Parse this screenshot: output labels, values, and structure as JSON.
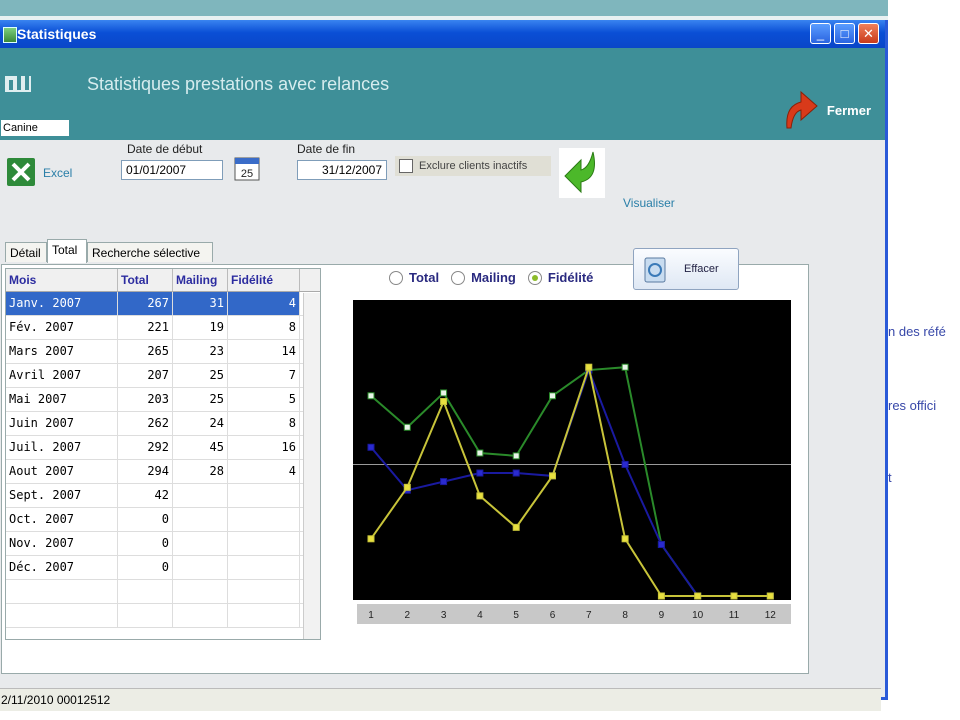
{
  "window": {
    "title": "Statistiques",
    "minimize": "_",
    "maximize": "□",
    "close": "✕"
  },
  "banner": {
    "heading": "Statistiques prestations avec relances",
    "combo_value": "Canine",
    "close_label": "Fermer"
  },
  "toolbar": {
    "excel_label": "Excel",
    "start_label": "Date de début",
    "start_value": "01/01/2007",
    "calendar_day": "25",
    "end_label": "Date de fin",
    "end_value": "31/12/2007",
    "exclude_label": "Exclure clients inactifs",
    "visualize_label": "Visualiser"
  },
  "tabs": [
    "Détail",
    "Total",
    "Recherche sélective"
  ],
  "table": {
    "headers": [
      "Mois",
      "Total",
      "Mailing",
      "Fidélité"
    ],
    "rows": [
      [
        "Janv. 2007",
        "267",
        "31",
        "4"
      ],
      [
        "Fév. 2007",
        "221",
        "19",
        "8"
      ],
      [
        "Mars 2007",
        "265",
        "23",
        "14"
      ],
      [
        "Avril 2007",
        "207",
        "25",
        "7"
      ],
      [
        "Mai 2007",
        "203",
        "25",
        "5"
      ],
      [
        "Juin 2007",
        "262",
        "24",
        "8"
      ],
      [
        "Juil. 2007",
        "292",
        "45",
        "16"
      ],
      [
        "Aout 2007",
        "294",
        "28",
        "4"
      ],
      [
        "Sept. 2007",
        "42",
        "",
        ""
      ],
      [
        "Oct. 2007",
        "0",
        "",
        ""
      ],
      [
        "Nov. 2007",
        "0",
        "",
        ""
      ],
      [
        "Déc. 2007",
        "0",
        "",
        ""
      ]
    ]
  },
  "radio": {
    "total": "Total",
    "mailing": "Mailing",
    "fidelite": "Fidélité",
    "selected": "fidelite"
  },
  "effacer_label": "Effacer",
  "status_text": "2/11/2010 00012512",
  "desktop_right": [
    "n des réfé",
    "res offici",
    "t"
  ],
  "chart_data": {
    "type": "line",
    "categories": [
      "1",
      "2",
      "3",
      "4",
      "5",
      "6",
      "7",
      "8",
      "9",
      "10",
      "11",
      "12"
    ],
    "series": [
      {
        "color": "#2a8a2a",
        "values": [
          70,
          59,
          71,
          50,
          49,
          70,
          79,
          80,
          18,
          0,
          0,
          0
        ]
      },
      {
        "color": "#1a1aa0",
        "values": [
          52,
          37,
          40,
          43,
          43,
          42,
          79,
          46,
          18,
          0,
          0,
          0
        ]
      },
      {
        "color": "#c8c43a",
        "values": [
          20,
          38,
          68,
          35,
          24,
          42,
          80,
          20,
          0,
          0,
          0,
          0
        ]
      }
    ],
    "ylim": [
      0,
      100
    ],
    "baseline": 46,
    "grid": false
  }
}
